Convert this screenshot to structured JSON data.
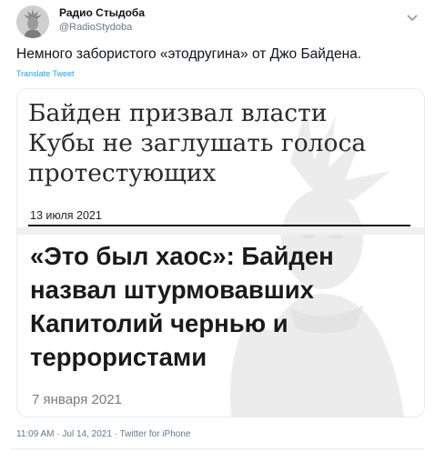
{
  "author": {
    "name": "Радио Стыдоба",
    "handle": "@RadioStydoba"
  },
  "tweet": {
    "text": "Немного забористого «этодругина» от Джо Байдена.",
    "translate_label": "Translate Tweet"
  },
  "media": {
    "headline1_line1": "Байден призвал власти",
    "headline1_line2": "Кубы не заглушать голоса",
    "headline1_line3": "протестующих",
    "date1": "13 июля 2021",
    "headline2_line1": "«Это был хаос»: Байден",
    "headline2_line2": "назвал штурмовавших",
    "headline2_line3": "Капитолий чернью и",
    "headline2_line4": "террористами",
    "date2": "7 января 2021"
  },
  "footer": {
    "time": "11:09 AM",
    "date": "Jul 14, 2021",
    "source": "Twitter for iPhone"
  },
  "colors": {
    "link": "#1da1f2",
    "muted": "#657786",
    "text": "#0f1419"
  }
}
